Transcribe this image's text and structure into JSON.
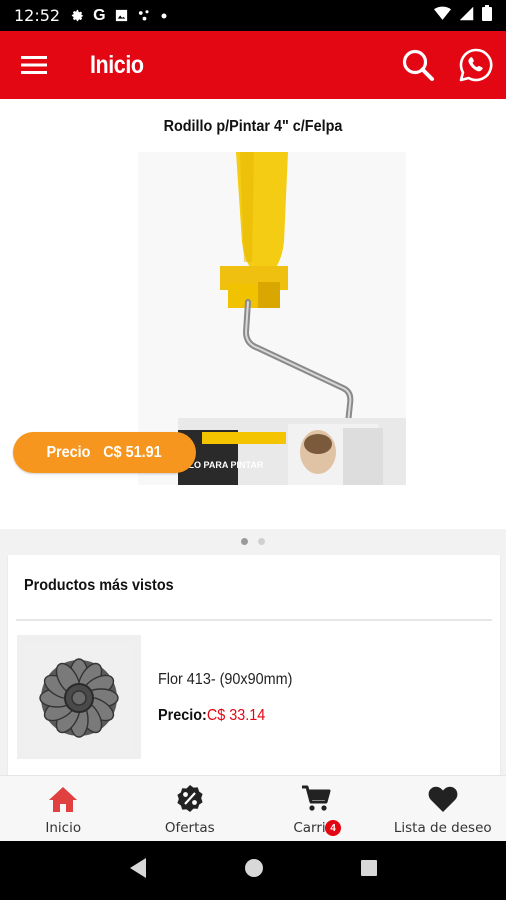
{
  "status_bar": {
    "time": "12:52",
    "icons_left": [
      "settings-icon",
      "google-icon",
      "gallery-icon",
      "dots-icon",
      "dot-icon"
    ],
    "icons_right": [
      "wifi-icon",
      "signal-icon",
      "battery-icon"
    ]
  },
  "app_bar": {
    "title": "Inicio",
    "background": "#e30613",
    "icons": [
      "menu-icon",
      "search-icon",
      "whatsapp-icon"
    ]
  },
  "hero": {
    "product_title": "Rodillo p/Pintar 4\" c/Felpa",
    "price_label": "Precio",
    "price_value": "C$ 51.91",
    "carousel_pages": 2,
    "carousel_active": 1,
    "package_text": "LLO PARA PINTAR"
  },
  "most_viewed": {
    "title": "Productos más vistos",
    "items": [
      {
        "name": "Flor 413- (90x90mm)",
        "price_label": "Precio:",
        "price_value": "C$ 33.14"
      }
    ]
  },
  "bottom_nav": {
    "items": [
      {
        "label": "Inicio",
        "icon": "home-icon",
        "active": true
      },
      {
        "label": "Ofertas",
        "icon": "discount-icon",
        "active": false
      },
      {
        "label": "Carrito",
        "icon": "cart-icon",
        "active": false,
        "badge": "4"
      },
      {
        "label": "Lista de deseo",
        "icon": "heart-icon",
        "active": false
      }
    ]
  },
  "colors": {
    "accent": "#e30613",
    "price_pill": "#f7961e",
    "active_nav": "#e04040"
  }
}
